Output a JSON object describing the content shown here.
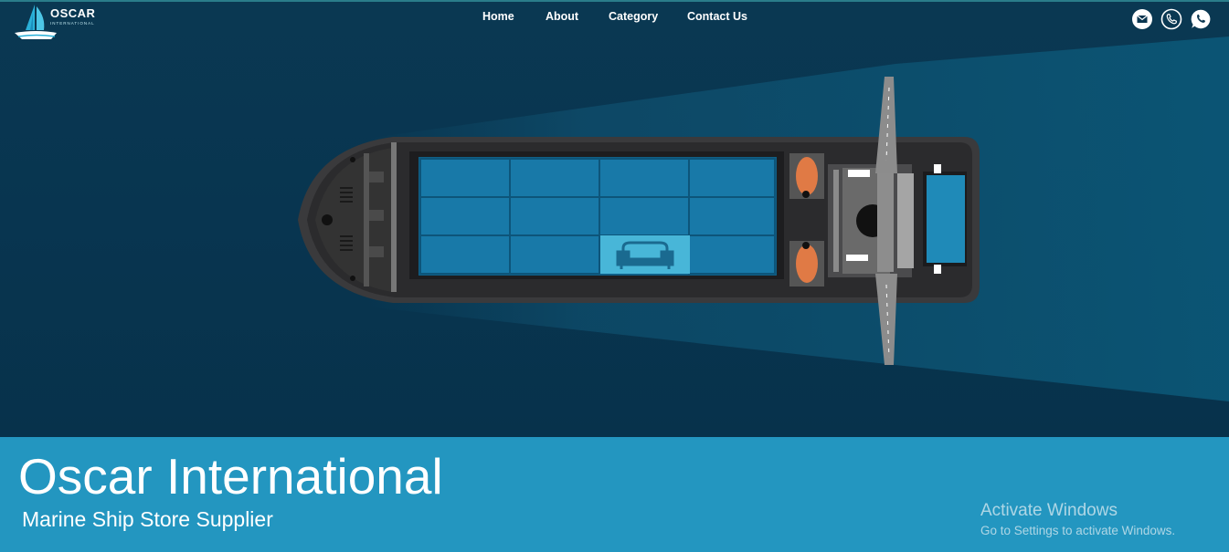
{
  "brand": {
    "name": "OSCAR",
    "tagline": "INTERNATIONAL"
  },
  "nav": {
    "items": [
      {
        "label": "Home"
      },
      {
        "label": "About"
      },
      {
        "label": "Category"
      },
      {
        "label": "Contact Us"
      }
    ]
  },
  "social": {
    "icons": [
      "mail-icon",
      "phone-icon",
      "whatsapp-icon"
    ]
  },
  "hero": {
    "title": "Oscar International",
    "subtitle": "Marine Ship Store Supplier"
  },
  "watermark": {
    "line1": "Activate Windows",
    "line2": "Go to Settings to activate Windows."
  },
  "colors": {
    "background": "#0a3650",
    "band": "#2396c0",
    "container": "#1a78a6",
    "accent": "#2a9fc9",
    "lifeboat": "#e07a45"
  }
}
